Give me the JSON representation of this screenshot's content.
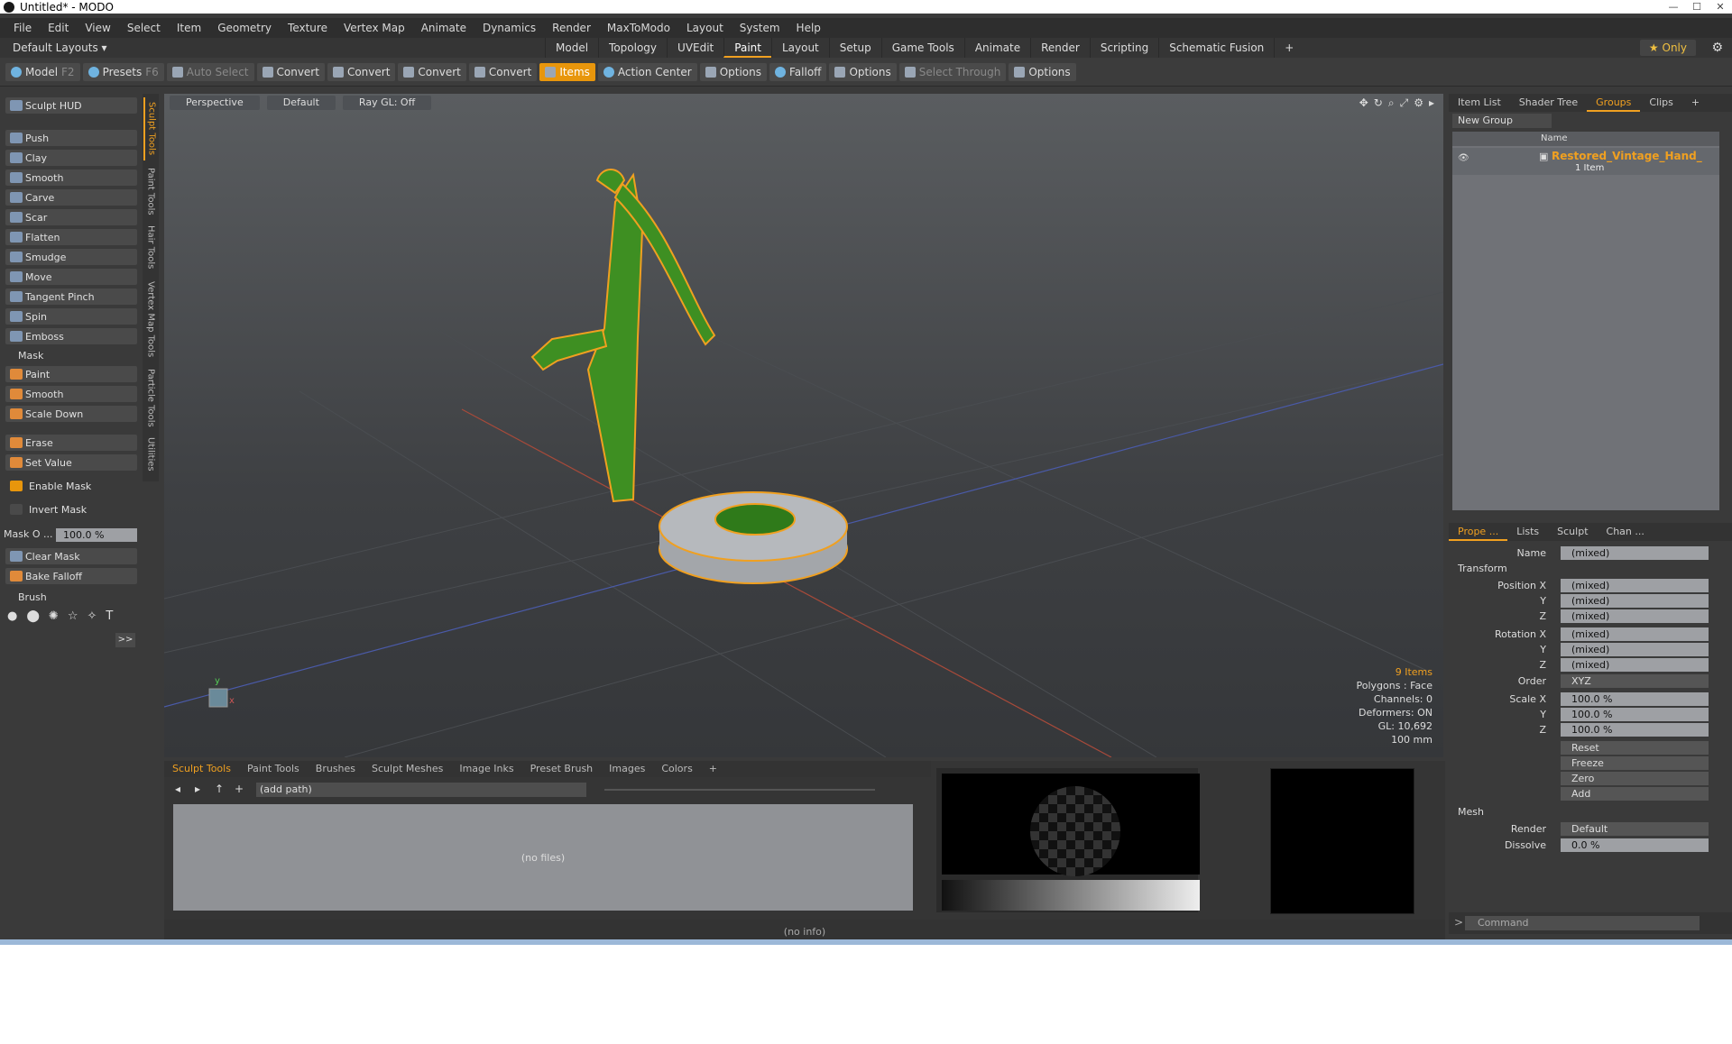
{
  "window": {
    "title": "Untitled* - MODO"
  },
  "menu": [
    "File",
    "Edit",
    "View",
    "Select",
    "Item",
    "Geometry",
    "Texture",
    "Vertex Map",
    "Animate",
    "Dynamics",
    "Render",
    "MaxToModo",
    "Layout",
    "System",
    "Help"
  ],
  "layouts": {
    "label": "Default Layouts",
    "tabs": [
      "Model",
      "Topology",
      "UVEdit",
      "Paint",
      "Layout",
      "Setup",
      "Game Tools",
      "Animate",
      "Render",
      "Scripting",
      "Schematic Fusion"
    ],
    "active": "Paint",
    "only": "Only"
  },
  "toolbar": {
    "model": "Model",
    "model_key": "F2",
    "presets": "Presets",
    "presets_key": "F6",
    "auto_select": "Auto Select",
    "convert": "Convert",
    "items": "Items",
    "action_center": "Action Center",
    "options": "Options",
    "falloff": "Falloff",
    "select_through": "Select Through"
  },
  "sculpt": {
    "hud": "Sculpt HUD",
    "tools": [
      "Push",
      "Clay",
      "Smooth",
      "Carve",
      "Scar",
      "Flatten",
      "Smudge",
      "Move",
      "Tangent Pinch",
      "Spin",
      "Emboss"
    ],
    "mask_label": "Mask",
    "mask_tools": [
      "Paint",
      "Smooth",
      "Scale Down"
    ],
    "erase": "Erase",
    "set_value": "Set Value",
    "enable_mask": "Enable Mask",
    "invert_mask": "Invert Mask",
    "mask_opacity_label": "Mask O ...",
    "mask_opacity": "100.0 %",
    "clear_mask": "Clear Mask",
    "bake_falloff": "Bake Falloff",
    "brush_label": "Brush"
  },
  "side_tabs": [
    "Sculpt Tools",
    "Paint Tools",
    "Hair Tools",
    "Vertex Map Tools",
    "Particle Tools",
    "Utilities"
  ],
  "viewport": {
    "perspective": "Perspective",
    "default": "Default",
    "raygl": "Ray GL: Off",
    "stats": {
      "items": "9 Items",
      "polygons": "Polygons : Face",
      "channels": "Channels: 0",
      "deformers": "Deformers: ON",
      "gl": "GL: 10,692",
      "units": "100 mm"
    }
  },
  "groups": {
    "tabs": [
      "Item List",
      "Shader Tree",
      "Groups",
      "Clips"
    ],
    "active": "Groups",
    "new_group": "New Group",
    "name_col": "Name",
    "item_name": "Restored_Vintage_Hand_",
    "item_count": "1 Item"
  },
  "properties": {
    "tabs": [
      "Prope ...",
      "Lists",
      "Sculpt",
      "Chan ..."
    ],
    "name_label": "Name",
    "name_value": "(mixed)",
    "transform": "Transform",
    "position_x": "Position X",
    "rotation_x": "Rotation X",
    "y": "Y",
    "z": "Z",
    "mixed": "(mixed)",
    "order_label": "Order",
    "order": "XYZ",
    "scale_x": "Scale X",
    "scale": "100.0 %",
    "reset": "Reset",
    "freeze": "Freeze",
    "zero": "Zero",
    "add": "Add",
    "mesh": "Mesh",
    "render_label": "Render",
    "render": "Default",
    "dissolve_label": "Dissolve",
    "dissolve": "0.0 %"
  },
  "bottom": {
    "tabs": [
      "Sculpt Tools",
      "Paint Tools",
      "Brushes",
      "Sculpt Meshes",
      "Image Inks",
      "Preset Brush",
      "Images",
      "Colors"
    ],
    "active": "Sculpt Tools",
    "path": "(add path)",
    "no_files": "(no files)",
    "status": "(no info)",
    "command": "Command"
  }
}
